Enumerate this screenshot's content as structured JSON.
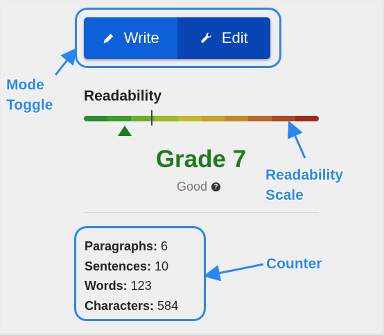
{
  "mode_toggle": {
    "write_label": "Write",
    "edit_label": "Edit",
    "active": "edit"
  },
  "readability": {
    "title": "Readability",
    "grade": "Grade 7",
    "rating": "Good",
    "scale_colors": [
      "#2e8b2e",
      "#3d9a2e",
      "#6cae2f",
      "#9cb82c",
      "#c5b82a",
      "#c7a12a",
      "#c3862a",
      "#b86a26",
      "#a84a22",
      "#9a2e1e"
    ],
    "grade_color": "#1e7a1e"
  },
  "counter": {
    "rows": [
      {
        "label": "Paragraphs:",
        "value": "6"
      },
      {
        "label": "Sentences:",
        "value": "10"
      },
      {
        "label": "Words:",
        "value": "123"
      },
      {
        "label": "Characters:",
        "value": "584"
      }
    ]
  },
  "annotations": {
    "mode_line1": "Mode",
    "mode_line2": "Toggle",
    "scale_line1": "Readability",
    "scale_line2": "Scale",
    "counter_label": "Counter",
    "accent_color": "#2a86f2"
  },
  "icons": {
    "write": "pencil-icon",
    "edit": "wrench-icon",
    "help": "question-circle-icon"
  }
}
